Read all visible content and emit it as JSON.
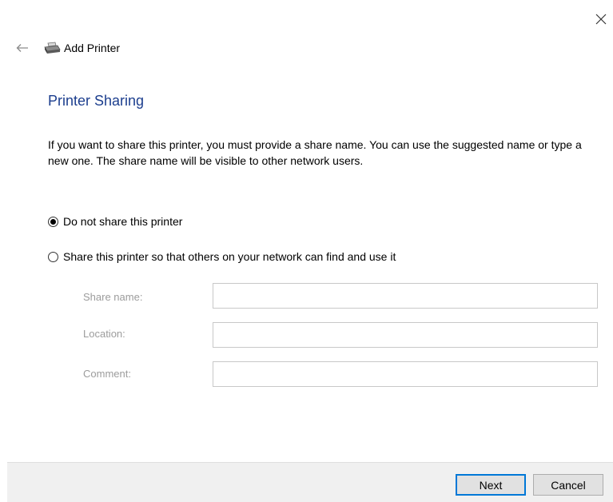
{
  "window": {
    "close_icon": "close-icon",
    "back_icon": "back-arrow-icon",
    "printer_icon": "printer-icon",
    "title": "Add Printer"
  },
  "main": {
    "heading": "Printer Sharing",
    "intro": "If you want to share this printer, you must provide a share name. You can use the suggested name or type a new one. The share name will be visible to other network users.",
    "options": [
      {
        "label": "Do not share this printer",
        "selected": true
      },
      {
        "label": "Share this printer so that others on your network can find and use it",
        "selected": false
      }
    ],
    "fields": [
      {
        "label": "Share name:",
        "value": ""
      },
      {
        "label": "Location:",
        "value": ""
      },
      {
        "label": "Comment:",
        "value": ""
      }
    ]
  },
  "footer": {
    "next_label": "Next",
    "cancel_label": "Cancel"
  },
  "colors": {
    "heading": "#1c3e8e",
    "disabled_label": "#9c9c9c",
    "footer_bg": "#f0f0f0",
    "primary_border": "#0078d7"
  }
}
